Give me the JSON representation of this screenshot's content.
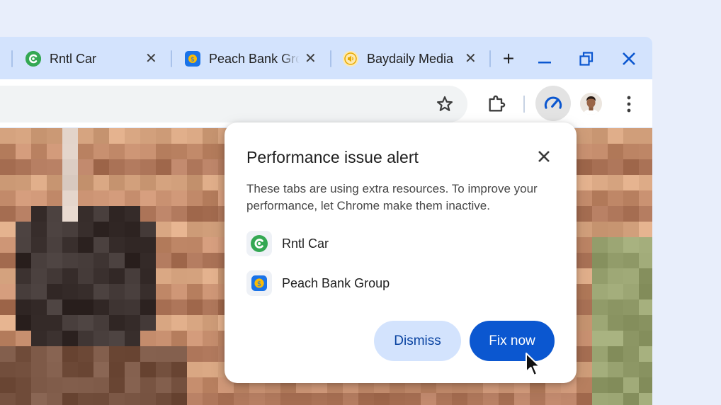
{
  "tabs": [
    {
      "title": "Rntl Car",
      "icon": "rntl-car-icon",
      "close": "✕"
    },
    {
      "title": "Peach Bank Group",
      "icon": "peach-bank-icon",
      "close": "✕"
    },
    {
      "title": "Baydaily Media",
      "icon": "baydaily-audio-icon",
      "close": "✕"
    }
  ],
  "window_controls": {
    "new_tab": "+",
    "minimize": "minimize-icon",
    "restore": "restore-icon",
    "close": "close-icon"
  },
  "toolbar": {
    "bookmark": "star-icon",
    "extensions": "puzzle-icon",
    "performance": "speedometer-icon",
    "profile": "avatar",
    "menu": "more-vert-icon"
  },
  "popup": {
    "title": "Performance issue alert",
    "body": "These tabs are using extra resources. To improve your performance, let Chrome make them inactive.",
    "items": [
      {
        "label": "Rntl Car",
        "icon": "rntl-car-icon"
      },
      {
        "label": "Peach Bank Group",
        "icon": "peach-bank-icon"
      }
    ],
    "dismiss_label": "Dismiss",
    "fix_label": "Fix now"
  },
  "colors": {
    "accent": "#0b57d0",
    "tab_strip": "#d3e3fd",
    "dismiss_bg": "#d3e3fd",
    "rntl_green": "#34a853",
    "peach_blue": "#1a73e8",
    "baydaily_yellow": "#fbbc04"
  }
}
